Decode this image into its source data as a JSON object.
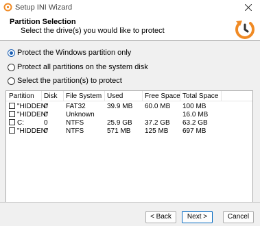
{
  "window": {
    "title": "Setup INI Wizard",
    "close_icon": "close-icon",
    "app_icon": "wizard-app-icon"
  },
  "header": {
    "title": "Partition Selection",
    "subtitle": "Select the drive(s) you would like to protect",
    "logo_icon": "restore-arrow-logo"
  },
  "options": [
    {
      "label": "Protect the Windows partition only",
      "selected": true
    },
    {
      "label": "Protect all partitions on the system disk",
      "selected": false
    },
    {
      "label": "Select the partition(s) to protect",
      "selected": false
    }
  ],
  "table": {
    "columns": [
      "Partition",
      "Disk",
      "File System",
      "Used",
      "Free Space",
      "Total Space"
    ],
    "rows": [
      {
        "partition": "\"HIDDEN\"",
        "disk": "0",
        "fs": "FAT32",
        "used": "39.9 MB",
        "free": "60.0 MB",
        "total": "100 MB",
        "checked": false
      },
      {
        "partition": "\"HIDDEN\"",
        "disk": "0",
        "fs": "Unknown",
        "used": "",
        "free": "",
        "total": "16.0 MB",
        "checked": false
      },
      {
        "partition": "C:",
        "disk": "0",
        "fs": "NTFS",
        "used": "25.9 GB",
        "free": "37.2 GB",
        "total": "63.2 GB",
        "checked": false
      },
      {
        "partition": "\"HIDDEN\"",
        "disk": "0",
        "fs": "NTFS",
        "used": "571 MB",
        "free": "125 MB",
        "total": "697 MB",
        "checked": false
      }
    ]
  },
  "footer": {
    "back_label": "< Back",
    "next_label": "Next >",
    "cancel_label": "Cancel"
  },
  "colors": {
    "accent": "#1a5fb4",
    "logo_orange": "#f08a24"
  }
}
